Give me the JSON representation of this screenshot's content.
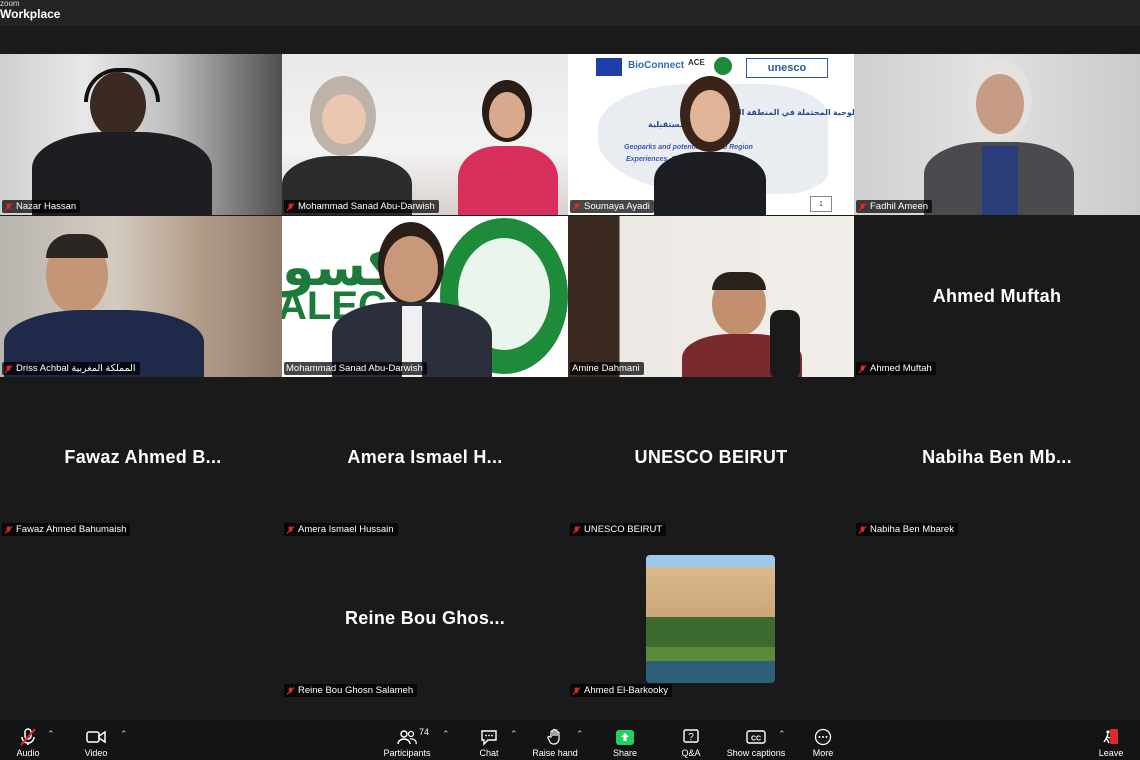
{
  "window": {
    "brand_small": "zoom",
    "brand_main": "Workplace"
  },
  "tiles": [
    {
      "caption": "Nazar Hassan",
      "type": "video"
    },
    {
      "caption": "Mohammad Sanad Abu-Darwish",
      "type": "video"
    },
    {
      "caption": "Soumaya Ayadi",
      "type": "video"
    },
    {
      "caption": "Fadhil Ameen",
      "type": "video"
    },
    {
      "caption": "Driss Achbal المملكة المغربية",
      "type": "video"
    },
    {
      "caption": "Mohammad Sanad Abu-Darwish",
      "type": "video",
      "active": true
    },
    {
      "caption": "Amine Dahmani",
      "type": "video"
    },
    {
      "caption": "Ahmed Muftah",
      "big": "Ahmed Muftah",
      "type": "name"
    },
    {
      "caption": "Fawaz Ahmed Bahumaish",
      "big": "Fawaz Ahmed B...",
      "type": "name"
    },
    {
      "caption": "Amera Ismael Hussain",
      "big": "Amera Ismael H...",
      "type": "name"
    },
    {
      "caption": "UNESCO BEIRUT",
      "big": "UNESCO BEIRUT",
      "type": "name"
    },
    {
      "caption": "Nabiha Ben Mbarek",
      "big": "Nabiha Ben Mb...",
      "type": "name"
    },
    {
      "caption": "Reine Bou Ghosn Salameh",
      "big": "Reine Bou Ghos...",
      "type": "name"
    },
    {
      "caption": "Ahmed El-Barkooky",
      "type": "image"
    }
  ],
  "slide": {
    "logos": [
      "BioConnect",
      "ACE",
      "unesco"
    ],
    "arabic_title": "المنتزهات الجيولوجية المحتملة في المنطقة العربية",
    "arabic_sub": "التجارب المستقبلية",
    "english_1": "Geoparks and potential ... Arab Region",
    "english_2": "Experiences, Ch... ...ctives",
    "page": "1"
  },
  "aleco_banner": {
    "text": "ALEC",
    "arabic": "كسو"
  },
  "toolbar": {
    "audio": "Audio",
    "video": "Video",
    "participants": "Participants",
    "participants_count": "74",
    "chat": "Chat",
    "raise_hand": "Raise hand",
    "share": "Share",
    "qa": "Q&A",
    "captions": "Show captions",
    "more": "More",
    "leave": "Leave"
  },
  "colors": {
    "accent_green": "#23d160",
    "mute_red": "#e02828"
  }
}
